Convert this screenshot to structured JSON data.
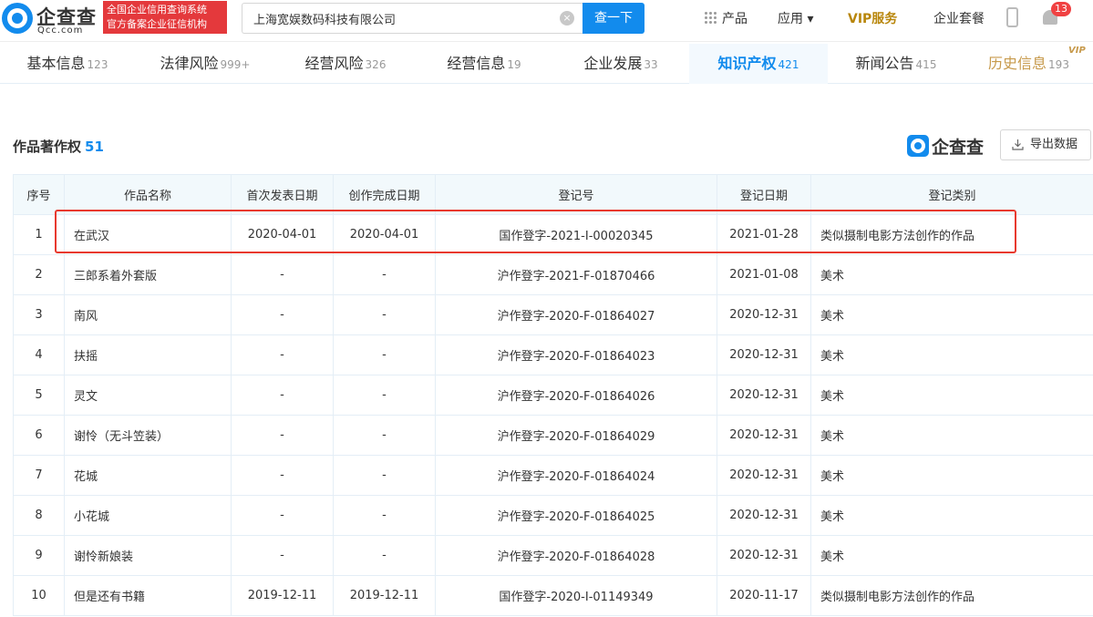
{
  "header": {
    "logo_name": "企查查",
    "logo_sub": "Qcc.com",
    "badge_line1": "全国企业信用查询系统",
    "badge_line2": "官方备案企业征信机构",
    "search_value": "上海宽娱数码科技有限公司",
    "search_button": "查一下",
    "nav_products": "产品",
    "nav_apps": "应用 ▾",
    "nav_vip": "VIP服务",
    "nav_package": "企业套餐",
    "notification_count": "13"
  },
  "tabs": [
    {
      "label": "基本信息",
      "count": "123"
    },
    {
      "label": "法律风险",
      "count": "999+"
    },
    {
      "label": "经营风险",
      "count": "326"
    },
    {
      "label": "经营信息",
      "count": "19"
    },
    {
      "label": "企业发展",
      "count": "33"
    },
    {
      "label": "知识产权",
      "count": "421"
    },
    {
      "label": "新闻公告",
      "count": "415"
    },
    {
      "label": "历史信息",
      "count": "193"
    }
  ],
  "vip_tag": "VIP",
  "section": {
    "title": "作品著作权",
    "count": "51",
    "brand": "企查查",
    "export_label": "导出数据"
  },
  "table": {
    "headers": [
      "序号",
      "作品名称",
      "首次发表日期",
      "创作完成日期",
      "登记号",
      "登记日期",
      "登记类别"
    ],
    "rows": [
      [
        "1",
        "在武汉",
        "2020-04-01",
        "2020-04-01",
        "国作登字-2021-I-00020345",
        "2021-01-28",
        "类似摄制电影方法创作的作品"
      ],
      [
        "2",
        "三郎系着外套版",
        "-",
        "-",
        "沪作登字-2021-F-01870466",
        "2021-01-08",
        "美术"
      ],
      [
        "3",
        "南风",
        "-",
        "-",
        "沪作登字-2020-F-01864027",
        "2020-12-31",
        "美术"
      ],
      [
        "4",
        "扶摇",
        "-",
        "-",
        "沪作登字-2020-F-01864023",
        "2020-12-31",
        "美术"
      ],
      [
        "5",
        "灵文",
        "-",
        "-",
        "沪作登字-2020-F-01864026",
        "2020-12-31",
        "美术"
      ],
      [
        "6",
        "谢怜（无斗笠装）",
        "-",
        "-",
        "沪作登字-2020-F-01864029",
        "2020-12-31",
        "美术"
      ],
      [
        "7",
        "花城",
        "-",
        "-",
        "沪作登字-2020-F-01864024",
        "2020-12-31",
        "美术"
      ],
      [
        "8",
        "小花城",
        "-",
        "-",
        "沪作登字-2020-F-01864025",
        "2020-12-31",
        "美术"
      ],
      [
        "9",
        "谢怜新娘装",
        "-",
        "-",
        "沪作登字-2020-F-01864028",
        "2020-12-31",
        "美术"
      ],
      [
        "10",
        "但是还有书籍",
        "2019-12-11",
        "2019-12-11",
        "国作登字-2020-I-01149349",
        "2020-11-17",
        "类似摄制电影方法创作的作品"
      ]
    ]
  }
}
